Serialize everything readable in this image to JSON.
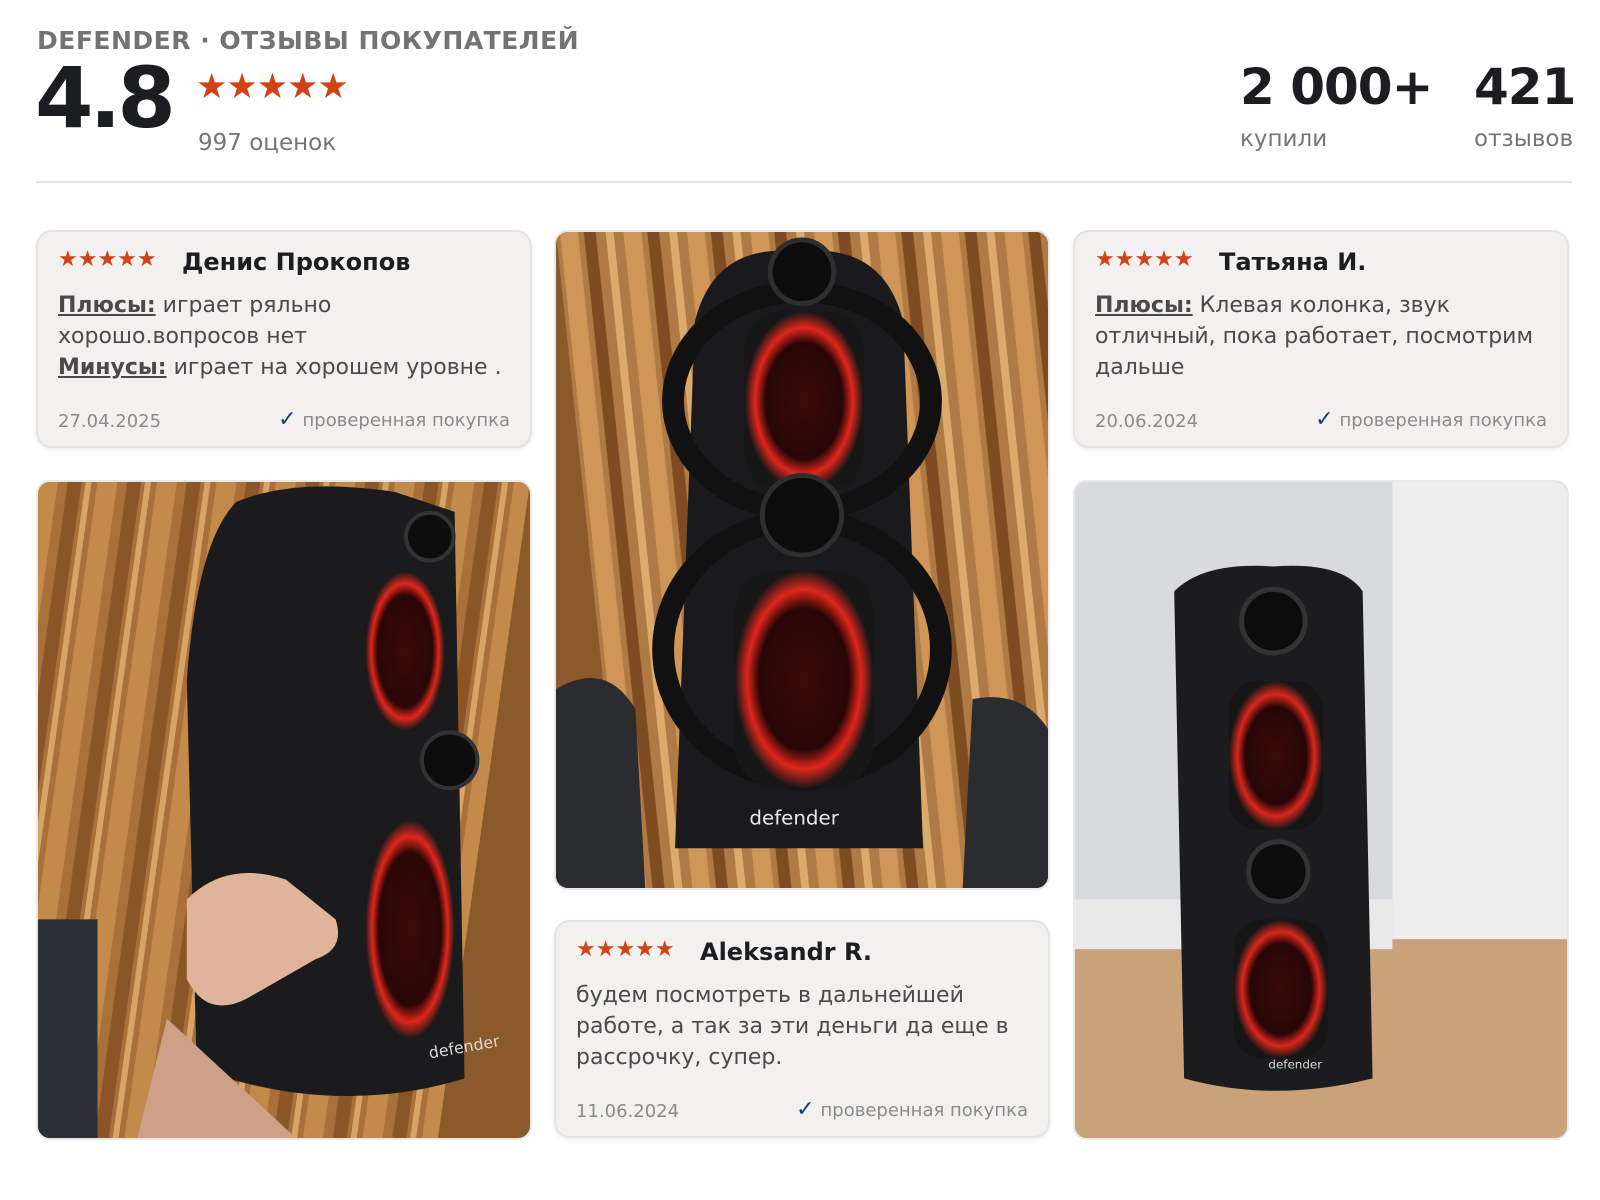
{
  "header": {
    "brand": "DEFENDER · ОТЗЫВЫ ПОКУПАТЕЛЕЙ",
    "rating": "4.8",
    "rating_stars": "★★★★★",
    "ratings_count": "997 оценок",
    "bought_value": "2 000+",
    "bought_label": "купили",
    "reviews_value": "421",
    "reviews_label": "отзывов"
  },
  "colors": {
    "star": "#cf4316",
    "card_bg": "#f2f1ef",
    "check": "#1e3a78",
    "speaker_light": "#e0261b"
  },
  "reviews": [
    {
      "stars": "★★★★★",
      "rating": 5,
      "author": "Денис Прокопов",
      "pros_label": "Плюсы:",
      "pros": "играет ряльно хорошо.вопросов нет",
      "cons_label": "Минусы:",
      "cons": "играет на хорошем уровне .",
      "date": "27.04.2025",
      "verified": "проверенная покупка"
    },
    {
      "stars": "★★★★★",
      "rating": 5,
      "author": "Aleksandr R.",
      "text": "будем посмотреть в дальнейшей работе, а так за эти деньги да еще в рассрочку, супер.",
      "date": "11.06.2024",
      "verified": "проверенная покупка"
    },
    {
      "stars": "★★★★★",
      "rating": 5,
      "author": "Татьяна И.",
      "pros_label": "Плюсы:",
      "pros": "Клевая колонка, звук отличный, пока работает, посмотрим дальше",
      "date": "20.06.2024",
      "verified": "проверенная покупка"
    }
  ],
  "photos": {
    "speaker_logo": "defender",
    "photo_1": "speaker-on-wood-floor-side-view",
    "photo_2": "speaker-on-wood-floor-top-view",
    "photo_3": "speaker-standing-against-wall"
  }
}
